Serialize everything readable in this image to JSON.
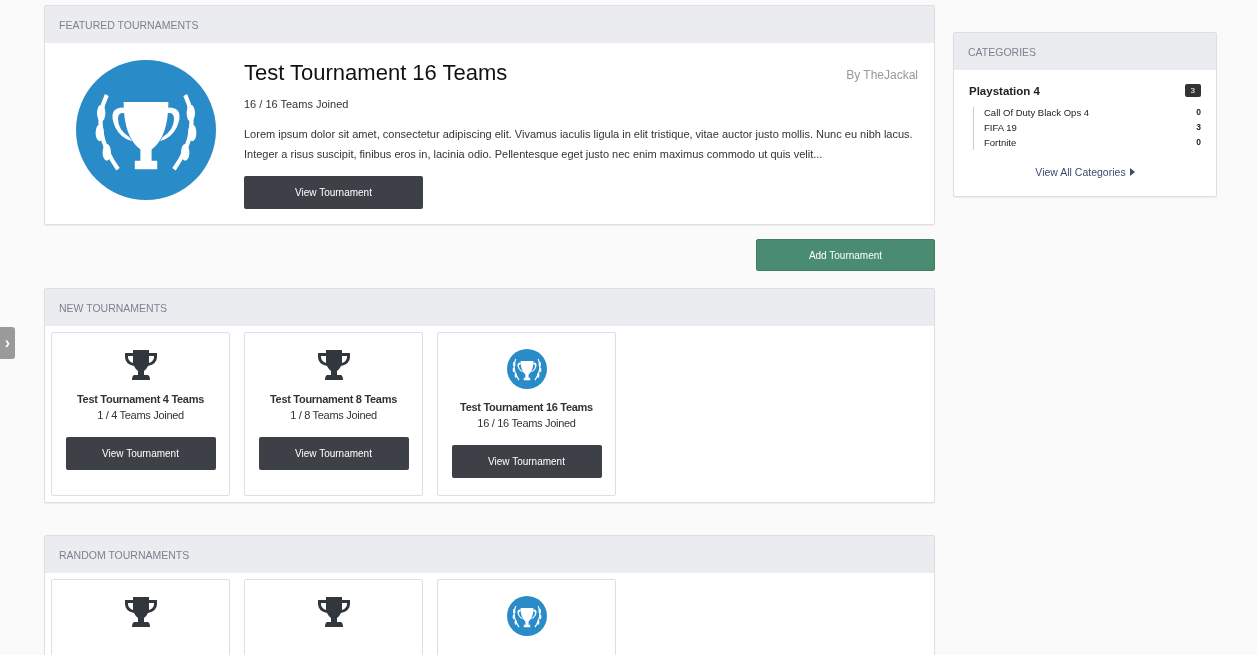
{
  "sidebar_toggle": {
    "icon": "›"
  },
  "featured": {
    "heading": "FEATURED TOURNAMENTS",
    "kind": "emblem",
    "title": "Test Tournament 16 Teams",
    "author": "By TheJackal",
    "joined": "16 / 16 Teams Joined",
    "description": "Lorem ipsum dolor sit amet, consectetur adipiscing elit. Vivamus iaculis ligula in elit tristique, vitae auctor justo mollis. Nunc eu nibh lacus. Integer a risus suscipit, finibus eros in, lacinia odio. Pellentesque eget justo nec enim maximus commodo ut quis velit...",
    "button": "View Tournament"
  },
  "add_button": "Add Tournament",
  "new_tournaments": {
    "heading": "NEW TOURNAMENTS",
    "cards": [
      {
        "kind": "trophy",
        "title": "Test Tournament 4 Teams",
        "joined": "1 / 4 Teams Joined",
        "button": "View Tournament"
      },
      {
        "kind": "trophy",
        "title": "Test Tournament 8 Teams",
        "joined": "1 / 8 Teams Joined",
        "button": "View Tournament"
      },
      {
        "kind": "emblem",
        "title": "Test Tournament 16 Teams",
        "joined": "16 / 16 Teams Joined",
        "button": "View Tournament"
      }
    ]
  },
  "random_tournaments": {
    "heading": "RANDOM TOURNAMENTS",
    "cards": [
      {
        "kind": "trophy"
      },
      {
        "kind": "trophy"
      },
      {
        "kind": "emblem"
      }
    ]
  },
  "categories": {
    "heading": "CATEGORIES",
    "groups": [
      {
        "name": "Playstation 4",
        "count": "3",
        "children": [
          {
            "name": "Call Of Duty Black Ops 4",
            "count": "0"
          },
          {
            "name": "FIFA 19",
            "count": "3"
          },
          {
            "name": "Fortnite",
            "count": "0"
          }
        ]
      }
    ],
    "link": "View All Categories"
  }
}
